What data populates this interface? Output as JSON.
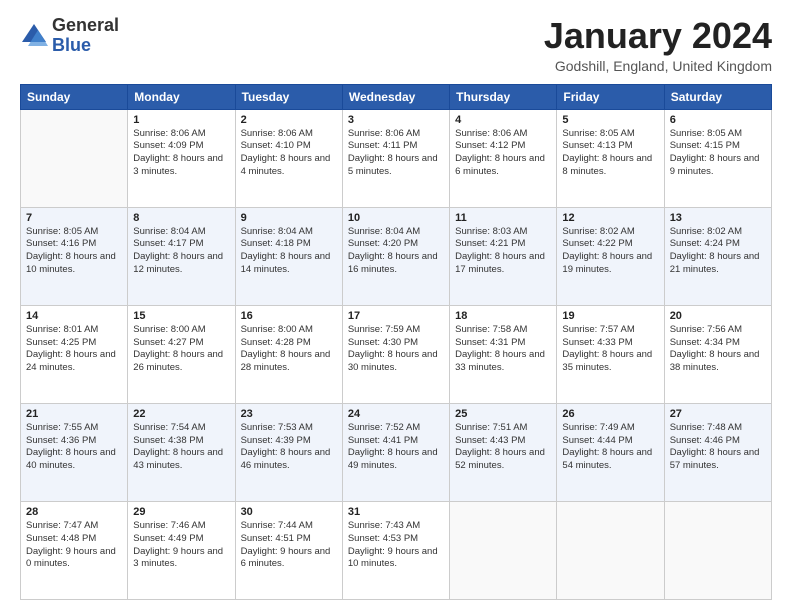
{
  "header": {
    "logo_general": "General",
    "logo_blue": "Blue",
    "month_title": "January 2024",
    "location": "Godshill, England, United Kingdom"
  },
  "weekdays": [
    "Sunday",
    "Monday",
    "Tuesday",
    "Wednesday",
    "Thursday",
    "Friday",
    "Saturday"
  ],
  "weeks": [
    [
      {
        "date": "",
        "sunrise": "",
        "sunset": "",
        "daylight": "",
        "empty": true
      },
      {
        "date": "1",
        "sunrise": "Sunrise: 8:06 AM",
        "sunset": "Sunset: 4:09 PM",
        "daylight": "Daylight: 8 hours and 3 minutes."
      },
      {
        "date": "2",
        "sunrise": "Sunrise: 8:06 AM",
        "sunset": "Sunset: 4:10 PM",
        "daylight": "Daylight: 8 hours and 4 minutes."
      },
      {
        "date": "3",
        "sunrise": "Sunrise: 8:06 AM",
        "sunset": "Sunset: 4:11 PM",
        "daylight": "Daylight: 8 hours and 5 minutes."
      },
      {
        "date": "4",
        "sunrise": "Sunrise: 8:06 AM",
        "sunset": "Sunset: 4:12 PM",
        "daylight": "Daylight: 8 hours and 6 minutes."
      },
      {
        "date": "5",
        "sunrise": "Sunrise: 8:05 AM",
        "sunset": "Sunset: 4:13 PM",
        "daylight": "Daylight: 8 hours and 8 minutes."
      },
      {
        "date": "6",
        "sunrise": "Sunrise: 8:05 AM",
        "sunset": "Sunset: 4:15 PM",
        "daylight": "Daylight: 8 hours and 9 minutes."
      }
    ],
    [
      {
        "date": "7",
        "sunrise": "Sunrise: 8:05 AM",
        "sunset": "Sunset: 4:16 PM",
        "daylight": "Daylight: 8 hours and 10 minutes."
      },
      {
        "date": "8",
        "sunrise": "Sunrise: 8:04 AM",
        "sunset": "Sunset: 4:17 PM",
        "daylight": "Daylight: 8 hours and 12 minutes."
      },
      {
        "date": "9",
        "sunrise": "Sunrise: 8:04 AM",
        "sunset": "Sunset: 4:18 PM",
        "daylight": "Daylight: 8 hours and 14 minutes."
      },
      {
        "date": "10",
        "sunrise": "Sunrise: 8:04 AM",
        "sunset": "Sunset: 4:20 PM",
        "daylight": "Daylight: 8 hours and 16 minutes."
      },
      {
        "date": "11",
        "sunrise": "Sunrise: 8:03 AM",
        "sunset": "Sunset: 4:21 PM",
        "daylight": "Daylight: 8 hours and 17 minutes."
      },
      {
        "date": "12",
        "sunrise": "Sunrise: 8:02 AM",
        "sunset": "Sunset: 4:22 PM",
        "daylight": "Daylight: 8 hours and 19 minutes."
      },
      {
        "date": "13",
        "sunrise": "Sunrise: 8:02 AM",
        "sunset": "Sunset: 4:24 PM",
        "daylight": "Daylight: 8 hours and 21 minutes."
      }
    ],
    [
      {
        "date": "14",
        "sunrise": "Sunrise: 8:01 AM",
        "sunset": "Sunset: 4:25 PM",
        "daylight": "Daylight: 8 hours and 24 minutes."
      },
      {
        "date": "15",
        "sunrise": "Sunrise: 8:00 AM",
        "sunset": "Sunset: 4:27 PM",
        "daylight": "Daylight: 8 hours and 26 minutes."
      },
      {
        "date": "16",
        "sunrise": "Sunrise: 8:00 AM",
        "sunset": "Sunset: 4:28 PM",
        "daylight": "Daylight: 8 hours and 28 minutes."
      },
      {
        "date": "17",
        "sunrise": "Sunrise: 7:59 AM",
        "sunset": "Sunset: 4:30 PM",
        "daylight": "Daylight: 8 hours and 30 minutes."
      },
      {
        "date": "18",
        "sunrise": "Sunrise: 7:58 AM",
        "sunset": "Sunset: 4:31 PM",
        "daylight": "Daylight: 8 hours and 33 minutes."
      },
      {
        "date": "19",
        "sunrise": "Sunrise: 7:57 AM",
        "sunset": "Sunset: 4:33 PM",
        "daylight": "Daylight: 8 hours and 35 minutes."
      },
      {
        "date": "20",
        "sunrise": "Sunrise: 7:56 AM",
        "sunset": "Sunset: 4:34 PM",
        "daylight": "Daylight: 8 hours and 38 minutes."
      }
    ],
    [
      {
        "date": "21",
        "sunrise": "Sunrise: 7:55 AM",
        "sunset": "Sunset: 4:36 PM",
        "daylight": "Daylight: 8 hours and 40 minutes."
      },
      {
        "date": "22",
        "sunrise": "Sunrise: 7:54 AM",
        "sunset": "Sunset: 4:38 PM",
        "daylight": "Daylight: 8 hours and 43 minutes."
      },
      {
        "date": "23",
        "sunrise": "Sunrise: 7:53 AM",
        "sunset": "Sunset: 4:39 PM",
        "daylight": "Daylight: 8 hours and 46 minutes."
      },
      {
        "date": "24",
        "sunrise": "Sunrise: 7:52 AM",
        "sunset": "Sunset: 4:41 PM",
        "daylight": "Daylight: 8 hours and 49 minutes."
      },
      {
        "date": "25",
        "sunrise": "Sunrise: 7:51 AM",
        "sunset": "Sunset: 4:43 PM",
        "daylight": "Daylight: 8 hours and 52 minutes."
      },
      {
        "date": "26",
        "sunrise": "Sunrise: 7:49 AM",
        "sunset": "Sunset: 4:44 PM",
        "daylight": "Daylight: 8 hours and 54 minutes."
      },
      {
        "date": "27",
        "sunrise": "Sunrise: 7:48 AM",
        "sunset": "Sunset: 4:46 PM",
        "daylight": "Daylight: 8 hours and 57 minutes."
      }
    ],
    [
      {
        "date": "28",
        "sunrise": "Sunrise: 7:47 AM",
        "sunset": "Sunset: 4:48 PM",
        "daylight": "Daylight: 9 hours and 0 minutes."
      },
      {
        "date": "29",
        "sunrise": "Sunrise: 7:46 AM",
        "sunset": "Sunset: 4:49 PM",
        "daylight": "Daylight: 9 hours and 3 minutes."
      },
      {
        "date": "30",
        "sunrise": "Sunrise: 7:44 AM",
        "sunset": "Sunset: 4:51 PM",
        "daylight": "Daylight: 9 hours and 6 minutes."
      },
      {
        "date": "31",
        "sunrise": "Sunrise: 7:43 AM",
        "sunset": "Sunset: 4:53 PM",
        "daylight": "Daylight: 9 hours and 10 minutes."
      },
      {
        "date": "",
        "sunrise": "",
        "sunset": "",
        "daylight": "",
        "empty": true
      },
      {
        "date": "",
        "sunrise": "",
        "sunset": "",
        "daylight": "",
        "empty": true
      },
      {
        "date": "",
        "sunrise": "",
        "sunset": "",
        "daylight": "",
        "empty": true
      }
    ]
  ]
}
